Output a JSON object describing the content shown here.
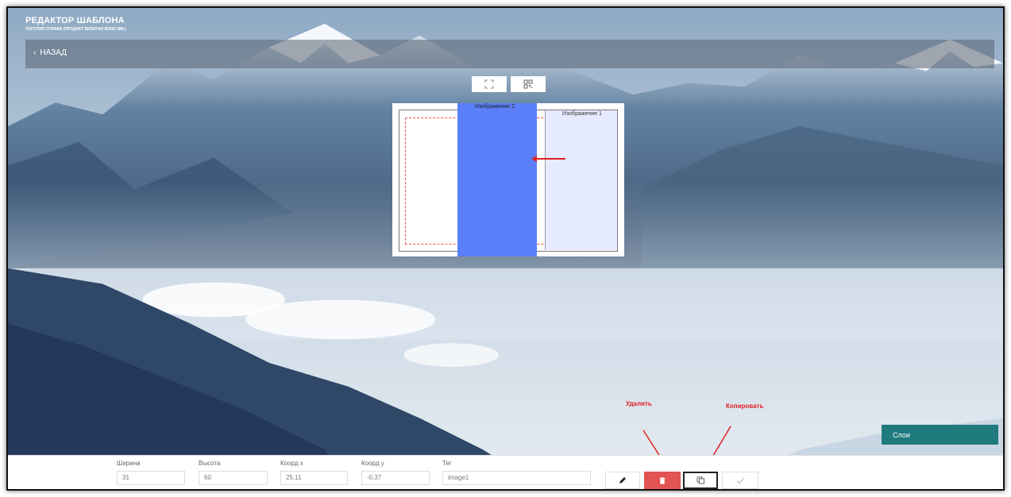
{
  "header": {
    "title": "РЕДАКТОР ШАБЛОНА",
    "subtitle": "ЛОГОТИП СПРАВА (ПРОДУКТ ВИЗИТКИ 85Х55 ММ.)"
  },
  "nav": {
    "back_label": "НАЗАД"
  },
  "toolbar": {
    "fullscreen_icon": "expand-icon",
    "qr_icon": "qr-code-icon"
  },
  "canvas": {
    "image1_label": "Изображение 1",
    "image2_label": "Изображение 2",
    "image1_color": "#e6eaff",
    "image2_color": "#5b7ff9"
  },
  "annotations": {
    "delete_label": "Удалить",
    "copy_label": "Копировать",
    "color": "#e02020"
  },
  "layers": {
    "label": "Слои",
    "color": "#1f7a7e"
  },
  "properties": {
    "width_label": "Ширина",
    "width_value": "31",
    "height_label": "Высота",
    "height_value": "60",
    "x_label": "Коорд x",
    "x_value": "25.11",
    "y_label": "Коорд y",
    "y_value": "-0.37",
    "tag_label": "Тег",
    "tag_value": "image1"
  },
  "actions": {
    "edit_icon": "pencil-icon",
    "delete_icon": "trash-icon",
    "copy_icon": "copy-icon",
    "confirm_icon": "check-icon",
    "delete_color": "#e25353"
  }
}
